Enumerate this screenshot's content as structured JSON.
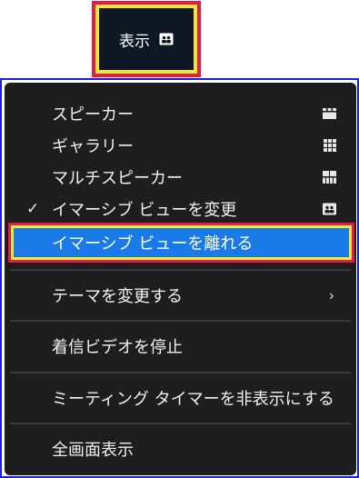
{
  "view_button": {
    "label": "表示",
    "icon": "immersive-view-icon"
  },
  "menu": {
    "layout_items": [
      {
        "label": "スピーカー",
        "icon": "speaker-view-icon"
      },
      {
        "label": "ギャラリー",
        "icon": "gallery-view-icon"
      },
      {
        "label": "マルチスピーカー",
        "icon": "multi-speaker-view-icon"
      },
      {
        "label": "イマーシブ ビューを変更",
        "icon": "immersive-view-icon",
        "checked": true
      }
    ],
    "highlighted_item": {
      "label": "イマーシブ ビューを離れる"
    },
    "theme_item": {
      "label": "テーマを変更する",
      "icon": "chevron-right-icon",
      "chevron": "›"
    },
    "stop_incoming_video": {
      "label": "着信ビデオを停止"
    },
    "hide_meeting_timer": {
      "label": "ミーティング タイマーを非表示にする"
    },
    "fullscreen": {
      "label": "全画面表示"
    },
    "check_mark": "✓"
  },
  "colors": {
    "highlight_red": "#e8194d",
    "highlight_yellow": "#f2ea2f",
    "selection_blue": "#1a7ae8",
    "frame_blue": "#1a22d8",
    "menu_bg": "#1e1e1e"
  }
}
